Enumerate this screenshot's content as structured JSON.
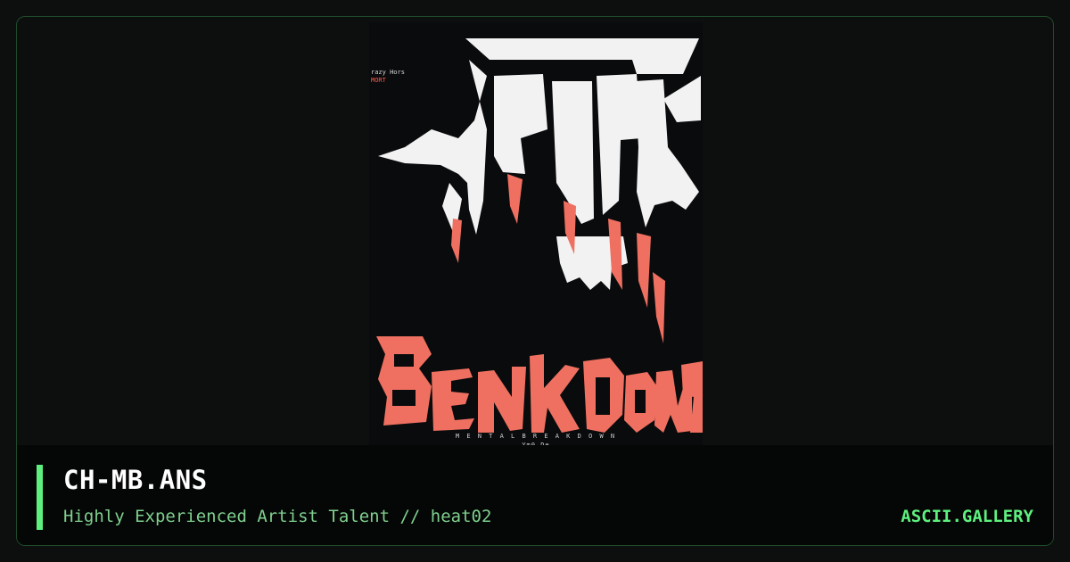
{
  "artwork": {
    "title_top": "MENTAL",
    "title_bottom": "BREAKDOWN",
    "side_text_line1": "razy Hors",
    "side_text_line2": "MORT",
    "credits_line1": "M E N T A L  B R E A K D O W N",
    "credits_line2": "Ym0 De",
    "colors": {
      "white": "#f2f2f2",
      "red": "#ef7060",
      "background": "#0a0b0d"
    }
  },
  "caption": {
    "filename": "CH-MB.ANS",
    "subtitle": "Highly Experienced Artist Talent // heat02",
    "brand": "ASCII.GALLERY",
    "accent_color": "#5ef07f"
  }
}
